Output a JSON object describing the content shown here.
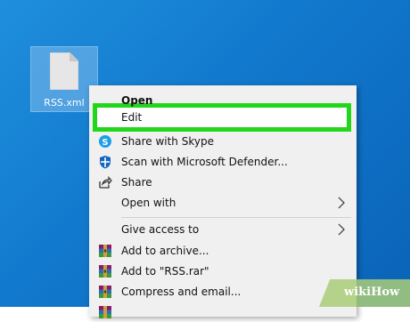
{
  "desktop": {
    "file": {
      "name": "RSS.xml",
      "icon": "document-icon"
    }
  },
  "menu": {
    "items": [
      {
        "label": "Open",
        "bold": true,
        "icon": ""
      },
      {
        "label": "Edit",
        "icon": ""
      },
      {
        "label": "Share with Skype",
        "icon": "skype-icon"
      },
      {
        "label": "Scan with Microsoft Defender...",
        "icon": "defender-shield-icon"
      },
      {
        "label": "Share",
        "icon": "share-icon"
      },
      {
        "label": "Open with",
        "icon": "",
        "submenu": true
      },
      {
        "label": "Give access to",
        "icon": "",
        "submenu": true
      },
      {
        "label": "Add to archive...",
        "icon": "winrar-icon"
      },
      {
        "label": "Add to \"RSS.rar\"",
        "icon": "winrar-icon"
      },
      {
        "label": "Compress and email...",
        "icon": "winrar-icon"
      }
    ],
    "highlight_color": "#22d61c"
  },
  "watermark": {
    "text": "wikiHow"
  }
}
